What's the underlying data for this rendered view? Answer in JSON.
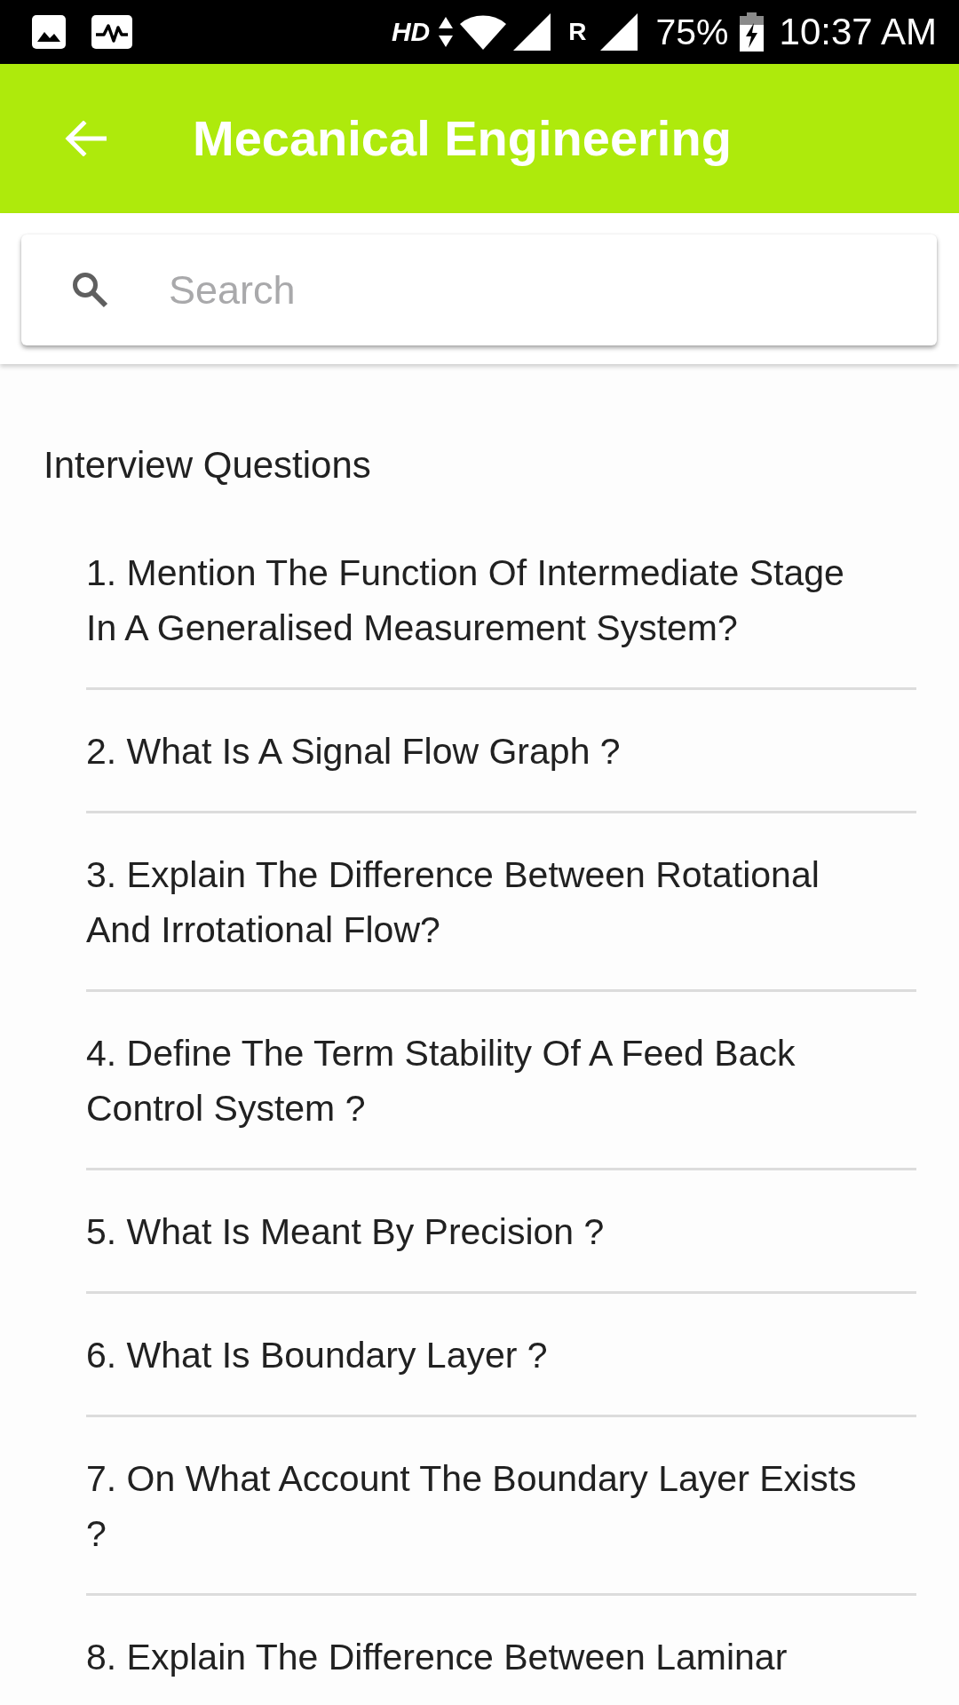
{
  "status_bar": {
    "network_type": "HD",
    "roaming": "R",
    "battery": "75%",
    "time": "10:37 AM"
  },
  "app_bar": {
    "title": "Mecanical Engineering"
  },
  "search": {
    "placeholder": "Search"
  },
  "section": {
    "title": "Interview Questions"
  },
  "questions": [
    {
      "text": "1. Mention The Function Of Intermediate Stage In A Generalised Measurement System?"
    },
    {
      "text": "2. What Is A Signal Flow Graph ?"
    },
    {
      "text": "3. Explain The Difference Between Rotational And Irrotational Flow?"
    },
    {
      "text": "4. Define The Term Stability Of A Feed Back Control System ?"
    },
    {
      "text": "5. What Is Meant By Precision ?"
    },
    {
      "text": "6. What Is Boundary Layer ?"
    },
    {
      "text": "7. On What Account The Boundary Layer Exists ?"
    },
    {
      "text": "8. Explain The Difference Between Laminar"
    }
  ]
}
